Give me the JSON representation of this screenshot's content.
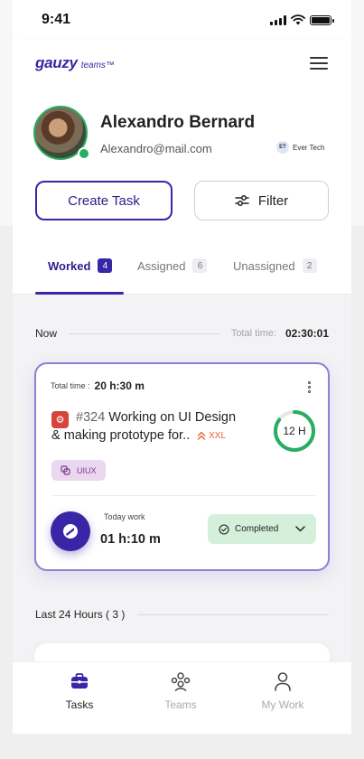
{
  "status_bar": {
    "time": "9:41"
  },
  "header": {
    "brand": "gauzy",
    "brand_suffix": "teams™"
  },
  "profile": {
    "name": "Alexandro Bernard",
    "email": "Alexandro@mail.com",
    "company_initials": "ET",
    "company_name": "Ever Tech",
    "online": true
  },
  "actions": {
    "create_task": "Create Task",
    "filter": "Filter"
  },
  "tabs": [
    {
      "label": "Worked",
      "count": "4",
      "active": true
    },
    {
      "label": "Assigned",
      "count": "6",
      "active": false
    },
    {
      "label": "Unassigned",
      "count": "2",
      "active": false
    }
  ],
  "section_now": {
    "label": "Now",
    "total_label": "Total time:",
    "total_value": "02:30:01"
  },
  "task_card": {
    "total_label": "Total time :",
    "total_value": "20 h:30 m",
    "task_number": "#324",
    "title_line1": "Working on UI Design",
    "title_line2": "& making prototype for..",
    "priority": "XXL",
    "estimate": "12 H",
    "estimate_progress": 0.85,
    "tag": "UIUX",
    "today_label": "Today work",
    "today_value": "01 h:10 m",
    "status": "Completed"
  },
  "section_last": {
    "label": "Last 24 Hours ( 3 )"
  },
  "bottom_nav": [
    {
      "label": "Tasks",
      "icon": "briefcase-icon",
      "active": true
    },
    {
      "label": "Teams",
      "icon": "team-icon",
      "active": false
    },
    {
      "label": "My Work",
      "icon": "user-icon",
      "active": false
    }
  ],
  "colors": {
    "primary": "#3826a6",
    "online": "#27ae60",
    "priority": "#e5662f",
    "status_bg": "#d4f0da",
    "tag_bg": "#ead7f0"
  }
}
